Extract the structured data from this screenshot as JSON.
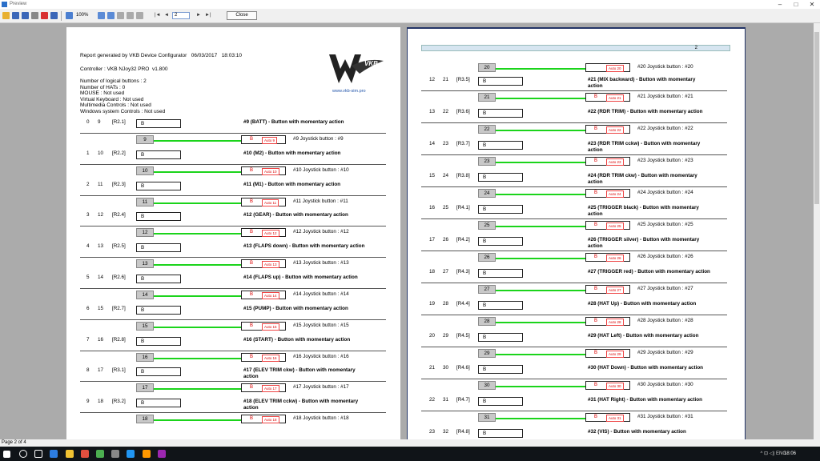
{
  "window": {
    "title": "Preview",
    "min": "–",
    "max": "□",
    "close": "✕"
  },
  "toolbar": {
    "zoom": "100%",
    "page_input": "2",
    "close_label": "Close",
    "nav_first": "|◄",
    "nav_prev": "◄",
    "nav_next": "►",
    "nav_last": "►|"
  },
  "status": {
    "page_of": "Page 2 of 4"
  },
  "report": {
    "line1": "Report generated by VKB Device Configurator   06/03/2017   18:03:10",
    "line2": "Controller : VKB NJoy32 PRO  v1.800",
    "line3": "Number of logical buttons : 2\nNumber of HATs : 0\nMOUSE : Not used\nVirtual Keyboard : Not used\nMultimedia Controls : Not used\nWindows system Controls : Not used",
    "logo_text": "VKB-sim",
    "logo_url": "www.vkb-sim.pro",
    "page2_number": "2"
  },
  "page1_rows": [
    {
      "a": "0",
      "b": "9",
      "c": "[R2.1]",
      "state": "B",
      "desc": "#9 (BATT) - Button with momentary action",
      "num": "9",
      "auto": "Auto 9",
      "jlabel": "#9  Joystick button : #9"
    },
    {
      "a": "1",
      "b": "10",
      "c": "[R2.2]",
      "state": "B",
      "desc": "#10 (M2) - Button with momentary action",
      "num": "10",
      "auto": "Auto 10",
      "jlabel": "#10  Joystick button : #10"
    },
    {
      "a": "2",
      "b": "11",
      "c": "[R2.3]",
      "state": "B",
      "desc": "#11 (M1) - Button with momentary action",
      "num": "11",
      "auto": "Auto 11",
      "jlabel": "#11  Joystick button : #11"
    },
    {
      "a": "3",
      "b": "12",
      "c": "[R2.4]",
      "state": "B",
      "desc": "#12 (GEAR) - Button with momentary action",
      "num": "12",
      "auto": "Auto 12",
      "jlabel": "#12  Joystick button : #12"
    },
    {
      "a": "4",
      "b": "13",
      "c": "[R2.5]",
      "state": "B",
      "desc": "#13 (FLAPS down) - Button with momentary action",
      "num": "13",
      "auto": "Auto 13",
      "jlabel": "#13  Joystick button : #13"
    },
    {
      "a": "5",
      "b": "14",
      "c": "[R2.6]",
      "state": "B",
      "desc": "#14 (FLAPS up) - Button with momentary action",
      "num": "14",
      "auto": "Auto 14",
      "jlabel": "#14  Joystick button : #14"
    },
    {
      "a": "6",
      "b": "15",
      "c": "[R2.7]",
      "state": "B",
      "desc": "#15 (PUMP) - Button with momentary action",
      "num": "15",
      "auto": "Auto 15",
      "jlabel": "#15  Joystick button : #15"
    },
    {
      "a": "7",
      "b": "16",
      "c": "[R2.8]",
      "state": "B",
      "desc": "#16 (START) - Button with momentary action",
      "num": "16",
      "auto": "Auto 16",
      "jlabel": "#16  Joystick button : #16"
    },
    {
      "a": "8",
      "b": "17",
      "c": "[R3.1]",
      "state": "B",
      "desc": "#17 (ELEV TRIM ckw) - Button with momentary\naction",
      "num": "17",
      "auto": "Auto 17",
      "jlabel": "#17  Joystick button : #17"
    },
    {
      "a": "9",
      "b": "18",
      "c": "[R3.2]",
      "state": "B",
      "desc": "#18 (ELEV TRIM cckw) - Button with momentary\naction",
      "num": "18",
      "auto": "Auto 18",
      "jlabel": "#18  Joystick button : #18"
    }
  ],
  "page2_rows": [
    {
      "a": "",
      "b": "",
      "c": "",
      "state": "",
      "desc": "",
      "num": "20",
      "auto": "Auto 20",
      "jlabel": "#20  Joystick button : #20"
    },
    {
      "a": "12",
      "b": "21",
      "c": "[R3.5]",
      "state": "B",
      "desc": "#21 (MIX backward) - Button with momentary\naction",
      "num": "21",
      "auto": "Auto 21",
      "jlabel": "#21  Joystick button : #21"
    },
    {
      "a": "13",
      "b": "22",
      "c": "[R3.6]",
      "state": "B",
      "desc": "#22 (RDR TRIM) - Button with momentary action",
      "num": "22",
      "auto": "Auto 22",
      "jlabel": "#22  Joystick button : #22"
    },
    {
      "a": "14",
      "b": "23",
      "c": "[R3.7]",
      "state": "B",
      "desc": "#23 (RDR TRIM cckw) - Button with momentary\naction",
      "num": "23",
      "auto": "Auto 23",
      "jlabel": "#23  Joystick button : #23"
    },
    {
      "a": "15",
      "b": "24",
      "c": "[R3.8]",
      "state": "B",
      "desc": "#24 (RDR TRIM ckw) - Button with momentary\naction",
      "num": "24",
      "auto": "Auto 24",
      "jlabel": "#24  Joystick button : #24"
    },
    {
      "a": "16",
      "b": "25",
      "c": "[R4.1]",
      "state": "B",
      "desc": "#25 (TRIGGER black) - Button with momentary\naction",
      "num": "25",
      "auto": "Auto 25",
      "jlabel": "#25  Joystick button : #25"
    },
    {
      "a": "17",
      "b": "26",
      "c": "[R4.2]",
      "state": "B",
      "desc": "#26 (TRIGGER silver) - Button with momentary\naction",
      "num": "26",
      "auto": "Auto 26",
      "jlabel": "#26  Joystick button : #26"
    },
    {
      "a": "18",
      "b": "27",
      "c": "[R4.3]",
      "state": "B",
      "desc": "#27 (TRIGGER red) - Button with momentary action",
      "num": "27",
      "auto": "Auto 27",
      "jlabel": "#27  Joystick button : #27"
    },
    {
      "a": "19",
      "b": "28",
      "c": "[R4.4]",
      "state": "B",
      "desc": "#28 (HAT Up) - Button with momentary action",
      "num": "28",
      "auto": "Auto 28",
      "jlabel": "#28  Joystick button : #28"
    },
    {
      "a": "20",
      "b": "29",
      "c": "[R4.5]",
      "state": "B",
      "desc": "#29 (HAT Left) - Button with momentary action",
      "num": "29",
      "auto": "Auto 29",
      "jlabel": "#29  Joystick button : #29"
    },
    {
      "a": "21",
      "b": "30",
      "c": "[R4.6]",
      "state": "B",
      "desc": "#30 (HAT Down) - Button with momentary action",
      "num": "30",
      "auto": "Auto 30",
      "jlabel": "#30  Joystick button : #30"
    },
    {
      "a": "22",
      "b": "31",
      "c": "[R4.7]",
      "state": "B",
      "desc": "#31 (HAT Right) - Button with momentary action",
      "num": "31",
      "auto": "Auto 31",
      "jlabel": "#31  Joystick button : #31"
    },
    {
      "a": "23",
      "b": "32",
      "c": "[R4.8]",
      "state": "B",
      "desc": "#32 (VIS) - Button with momentary action",
      "num": "",
      "auto": "",
      "jlabel": ""
    }
  ],
  "taskbar": {
    "clock": "18:06",
    "tray": "^  ⊡  ◁)  ENG"
  }
}
